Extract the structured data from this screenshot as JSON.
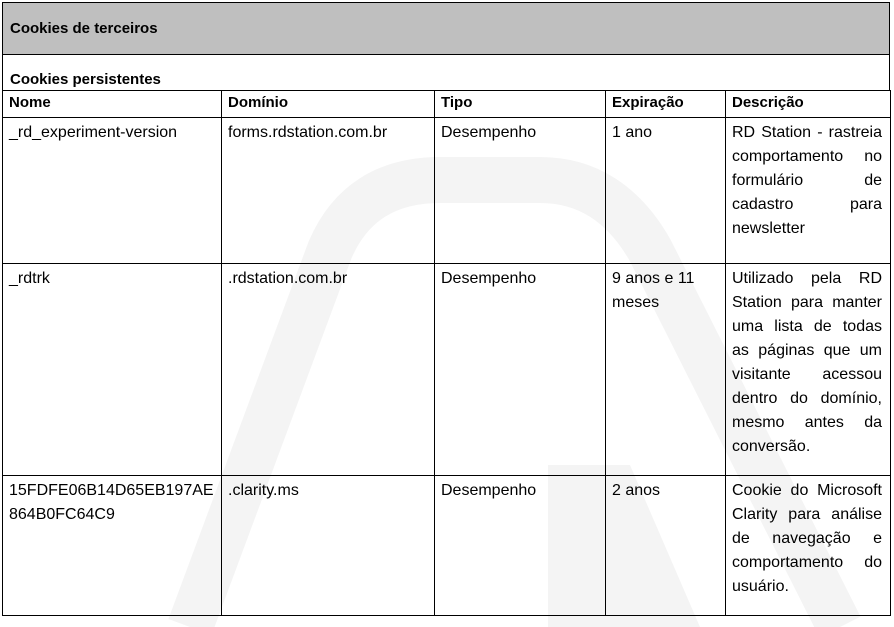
{
  "section_title": "Cookies de terceiros",
  "subsection_title": "Cookies persistentes",
  "columns": {
    "nome": "Nome",
    "dominio": "Domínio",
    "tipo": "Tipo",
    "expiracao": "Expiração",
    "descricao": "Descrição"
  },
  "rows": [
    {
      "nome": "_rd_experiment-version",
      "dominio": "forms.rdstation.com.br",
      "tipo": "Desempenho",
      "expiracao": "1 ano",
      "descricao": "RD Station - rastreia comportamento no formulário de cadastro para newsletter"
    },
    {
      "nome": "_rdtrk",
      "dominio": ".rdstation.com.br",
      "tipo": "Desempenho",
      "expiracao": "9 anos e 11 meses",
      "descricao": "Utilizado pela RD Station para manter uma lista de todas as páginas que um visitante acessou dentro do domínio, mesmo antes da conversão."
    },
    {
      "nome": "15FDFE06B14D65EB197AE864B0FC64C9",
      "dominio": ".clarity.ms",
      "tipo": "Desempenho",
      "expiracao": "2 anos",
      "descricao": "Cookie do Microsoft Clarity para análise de navegação e comportamento do usuário."
    }
  ]
}
